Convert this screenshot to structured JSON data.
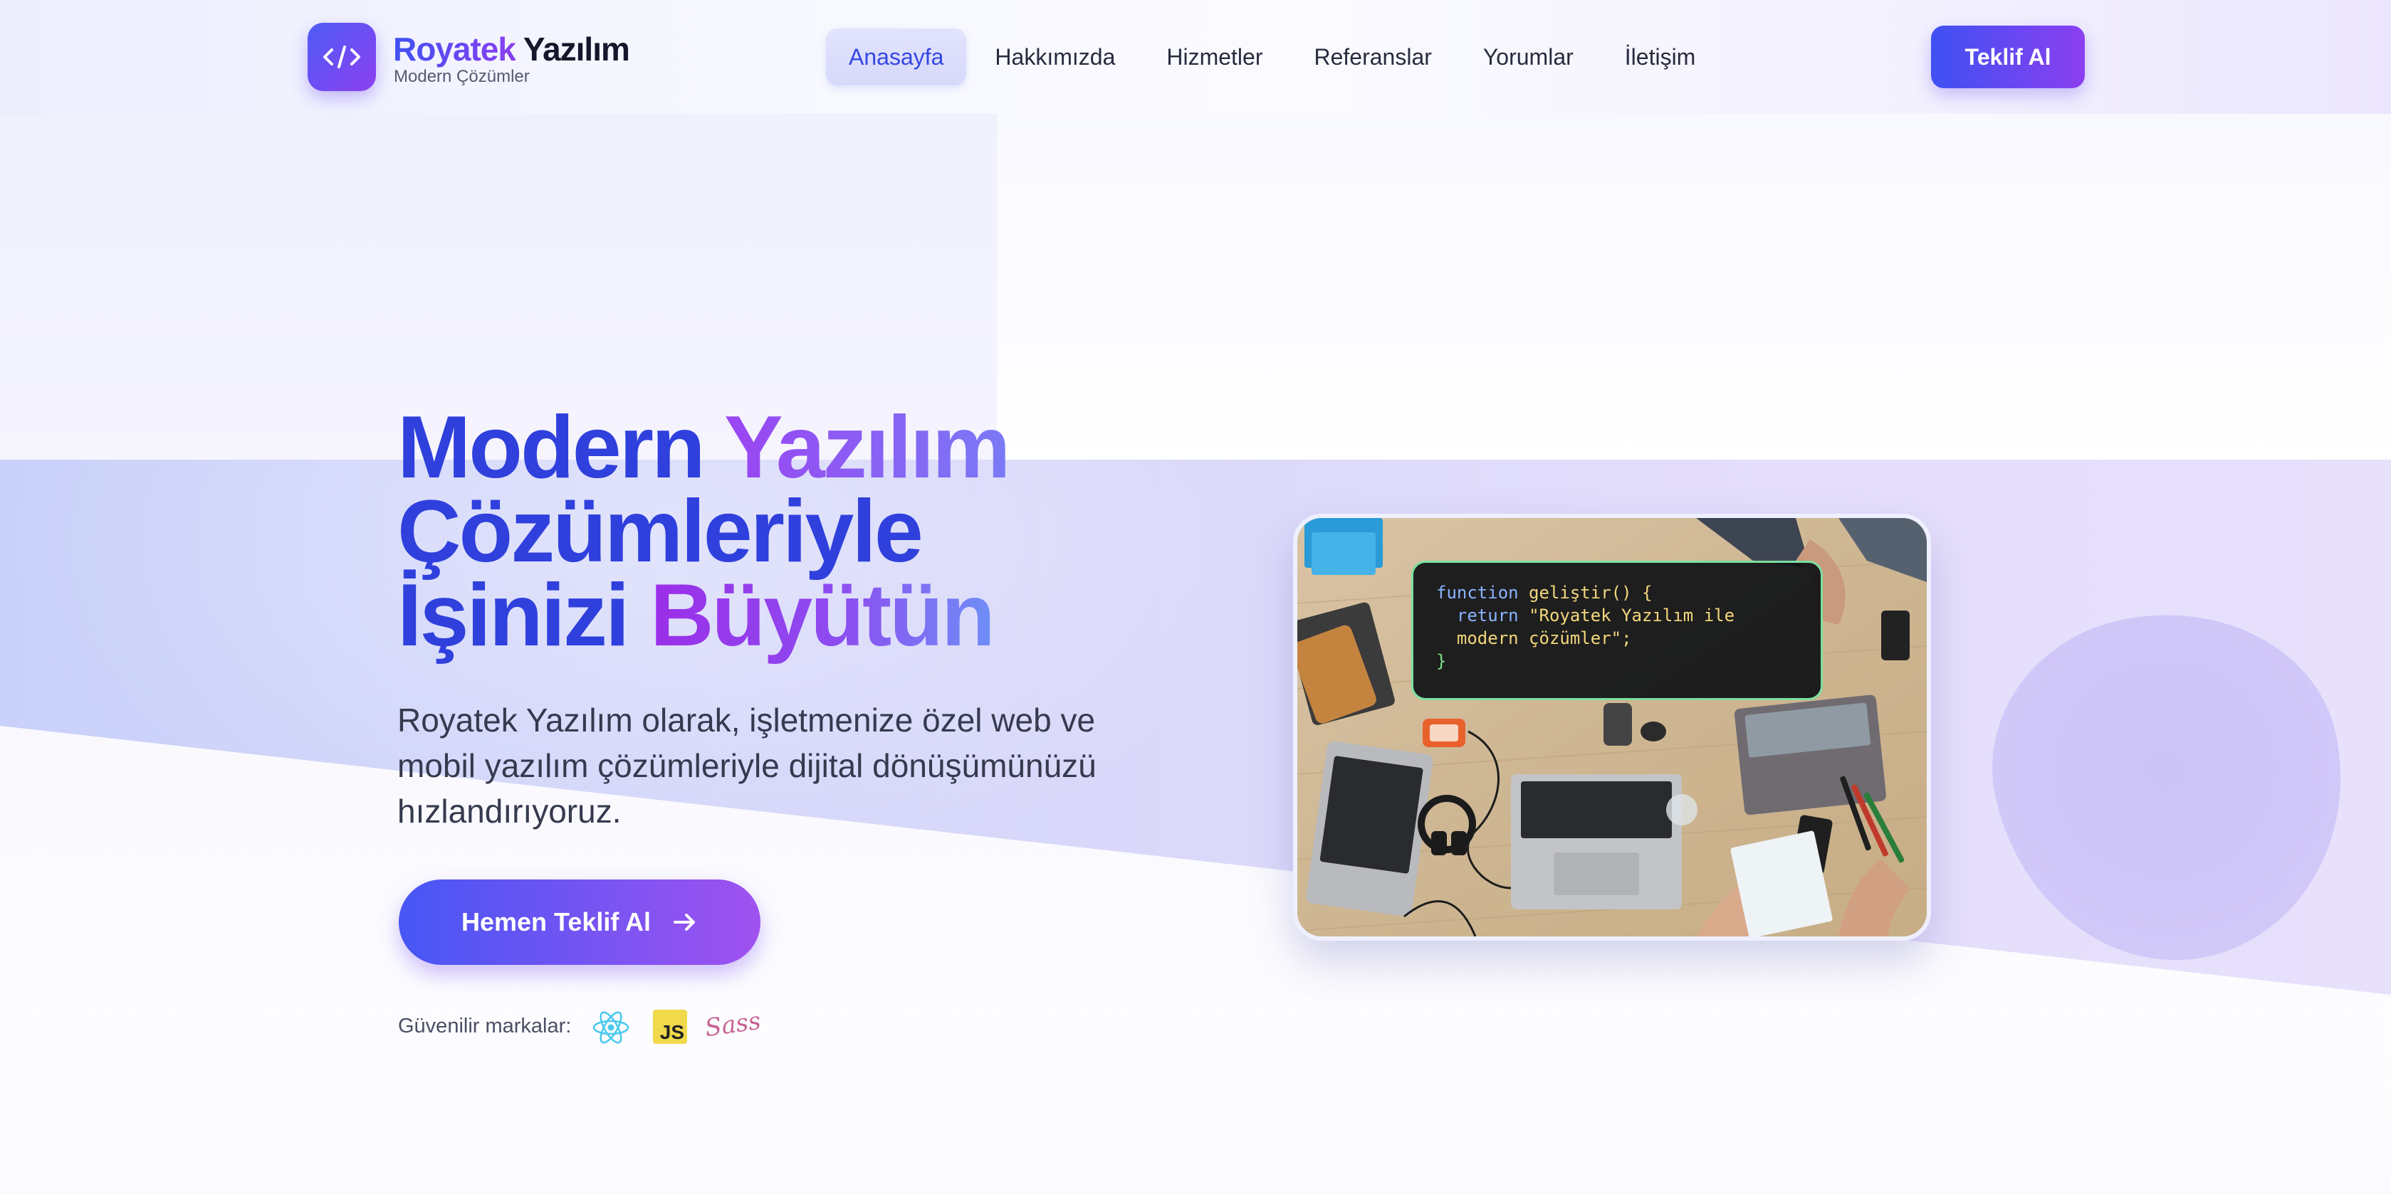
{
  "brand": {
    "name_part1": "Royatek",
    "name_part2": "Yazılım",
    "tagline": "Modern Çözümler",
    "logo_icon": "code-brackets-icon"
  },
  "nav": {
    "items": [
      {
        "label": "Anasayfa",
        "active": true
      },
      {
        "label": "Hakkımızda",
        "active": false
      },
      {
        "label": "Hizmetler",
        "active": false
      },
      {
        "label": "Referanslar",
        "active": false
      },
      {
        "label": "Yorumlar",
        "active": false
      },
      {
        "label": "İletişim",
        "active": false
      }
    ],
    "cta_label": "Teklif Al"
  },
  "hero": {
    "title_line1_a": "Modern",
    "title_line1_b": "Yazılım",
    "title_line2": "Çözümleriyle",
    "title_line3_a": "İşinizi",
    "title_line3_b": "Büyütün",
    "description": "Royatek Yazılım olarak, işletmenize özel web ve mobil yazılım çözümleriyle dijital dönüşümünüzü hızlandırıyoruz.",
    "button_label": "Hemen Teklif Al",
    "button_icon": "arrow-right-icon",
    "brands_label": "Güvenilir markalar:",
    "brands": [
      {
        "icon": "react-icon"
      },
      {
        "icon": "javascript-icon",
        "text": "JS"
      },
      {
        "icon": "sass-icon",
        "text": "Sass"
      }
    ]
  },
  "code_snippet": {
    "keyword_function": "function",
    "function_name": "geliştir() {",
    "keyword_return": "return",
    "string_line1": "\"Royatek Yazılım ile",
    "string_line2": "modern çözümler\";",
    "closing": "}"
  },
  "colors": {
    "primary": "#3f51f2",
    "secondary": "#8b3ff0",
    "text_dark": "#15182b"
  }
}
